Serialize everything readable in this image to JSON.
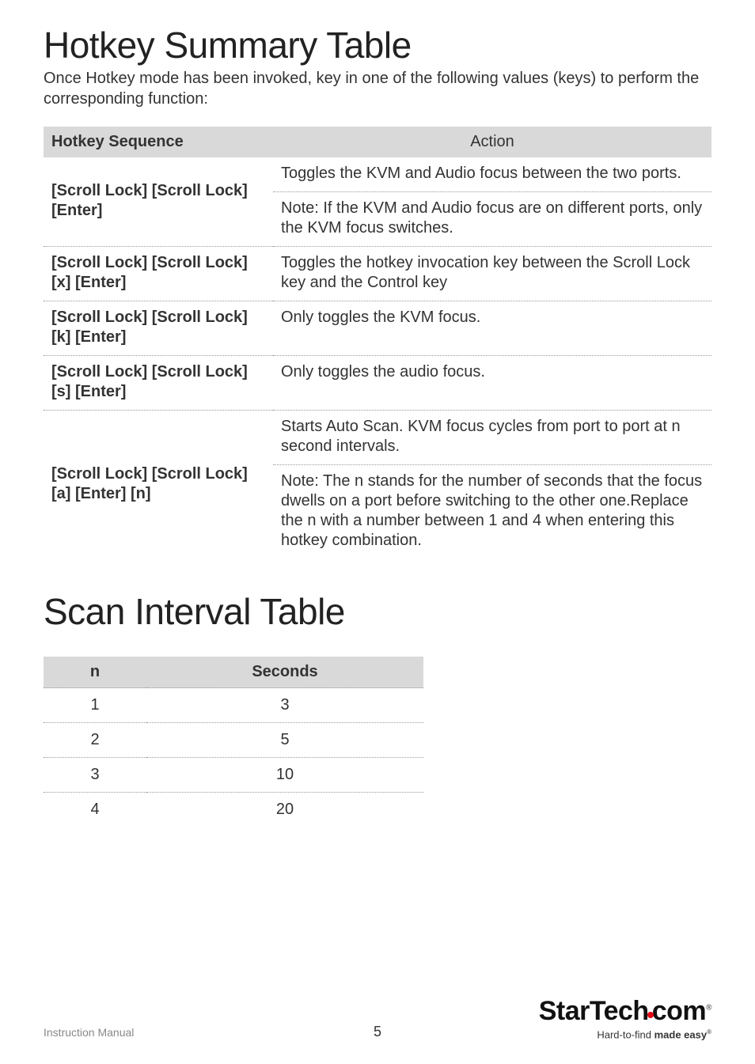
{
  "title1": "Hotkey Summary Table",
  "intro": "Once Hotkey mode has been invoked, key in one of the following values (keys) to perform the corresponding function:",
  "hotkey_table": {
    "header": {
      "col1": "Hotkey Sequence",
      "col2": "Action"
    },
    "rows": [
      {
        "key": "[Scroll Lock] [Scroll Lock] [Enter]",
        "action1": "Toggles the KVM and Audio focus between the two ports.",
        "action2": "Note: If the KVM and Audio focus are on different ports, only the KVM focus switches."
      },
      {
        "key": "[Scroll Lock] [Scroll Lock] [x] [Enter]",
        "action": "Toggles the hotkey invocation key between the Scroll Lock key and the Control key"
      },
      {
        "key": "[Scroll Lock] [Scroll Lock] [k] [Enter]",
        "action": "Only toggles the KVM focus."
      },
      {
        "key": "[Scroll Lock] [Scroll Lock] [s] [Enter]",
        "action": "Only toggles the audio focus."
      },
      {
        "key": "[Scroll Lock] [Scroll Lock] [a] [Enter] [n]",
        "action1": "Starts Auto Scan. KVM focus cycles from port to port at n second intervals.",
        "action2": "Note: The n stands for the number of seconds that the focus dwells on a port before switching to the other one.Replace the n with a number between 1 and 4 when entering this hotkey combination."
      }
    ]
  },
  "title2": "Scan Interval Table",
  "scan_table": {
    "header": {
      "col1": "n",
      "col2": "Seconds"
    },
    "rows": [
      {
        "n": "1",
        "seconds": "3"
      },
      {
        "n": "2",
        "seconds": "5"
      },
      {
        "n": "3",
        "seconds": "10"
      },
      {
        "n": "4",
        "seconds": "20"
      }
    ]
  },
  "footer": {
    "left": "Instruction Manual",
    "page": "5",
    "logo_pre": "StarTech",
    "logo_post": "com",
    "tagline_pre": "Hard-to-find ",
    "tagline_bold": "made easy"
  }
}
